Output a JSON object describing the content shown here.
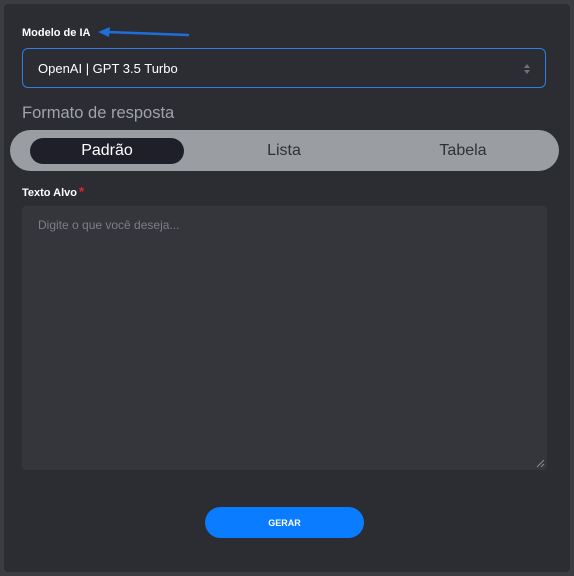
{
  "model": {
    "label": "Modelo de IA",
    "selected": "OpenAI | GPT 3.5 Turbo"
  },
  "format": {
    "title": "Formato de resposta",
    "tabs": [
      "Padrão",
      "Lista",
      "Tabela"
    ],
    "active": "Padrão"
  },
  "target": {
    "label": "Texto Alvo",
    "required_mark": "*",
    "placeholder": "Digite o que você deseja..."
  },
  "submit": {
    "label": "GERAR"
  },
  "colors": {
    "accent": "#0a7cff",
    "select_border": "#2f7ee0",
    "required": "#e5232e",
    "annotation_arrow": "#1e6fd9"
  }
}
